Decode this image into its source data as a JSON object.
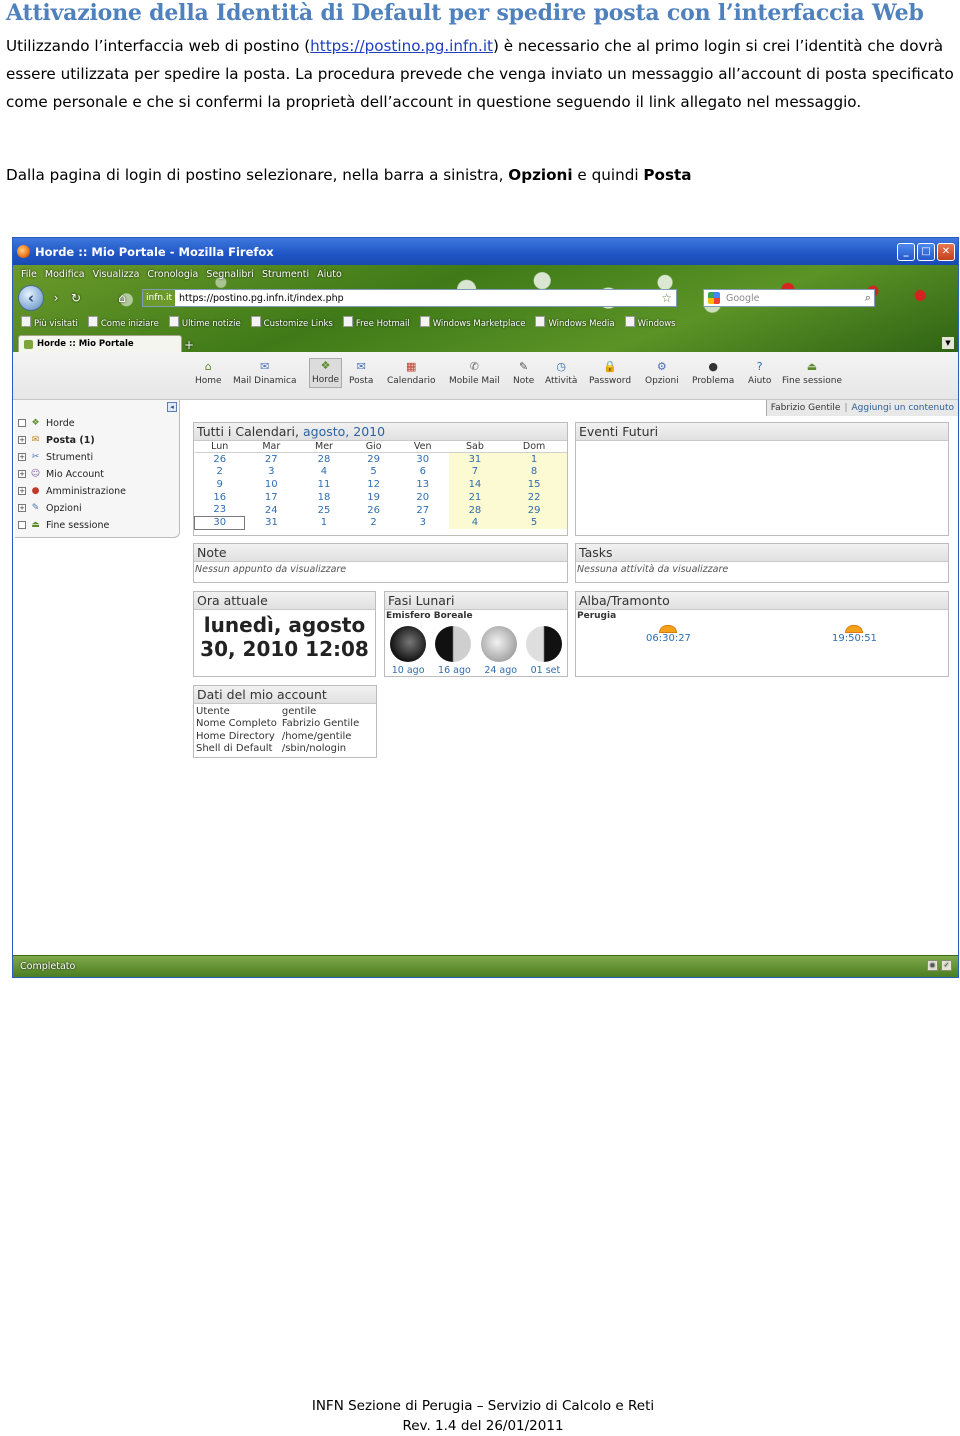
{
  "document": {
    "title": "Attivazione della Identità di Default per spedire posta con l’interfaccia Web",
    "para1_prefix": "Utilizzando l’interfaccia web di postino (",
    "para1_link": "https://postino.pg.infn.it",
    "para1_suffix": ") è necessario che al primo login si crei l’identità che dovrà essere utilizzata per spedire la posta. La procedura prevede che venga inviato un messaggio all’account di posta specificato come personale e che si confermi la proprietà dell’account in questione seguendo il link allegato nel messaggio.",
    "para2_prefix": "Dalla pagina di login di postino selezionare, nella barra a sinistra, ",
    "para2_opzioni": "Opzioni",
    "para2_mid": " e quindi ",
    "para2_posta": "Posta",
    "footer_line1": "INFN Sezione di Perugia – Servizio di Calcolo e Reti",
    "footer_line2": "Rev. 1.4 del 26/01/2011"
  },
  "browser": {
    "window_title": "Horde :: Mio Portale - Mozilla Firefox",
    "menu": [
      "File",
      "Modifica",
      "Visualizza",
      "Cronologia",
      "Segnalibri",
      "Strumenti",
      "Aiuto"
    ],
    "url_badge": "infn.it",
    "url": "https://postino.pg.infn.it/index.php",
    "search_placeholder": "Google",
    "bookmarks": [
      "Più visitati",
      "Come iniziare",
      "Ultime notizie",
      "Customize Links",
      "Free Hotmail",
      "Windows Marketplace",
      "Windows Media",
      "Windows"
    ],
    "tab_title": "Horde :: Mio Portale",
    "status_text": "Completato"
  },
  "horde": {
    "menu": [
      {
        "label": "Home",
        "icon": "home-icon"
      },
      {
        "label": "Mail Dinamica",
        "icon": "mail-icon"
      },
      {
        "label": "Horde",
        "icon": "horde-icon"
      },
      {
        "label": "Posta",
        "icon": "inbox-icon"
      },
      {
        "label": "Calendario",
        "icon": "calendar-icon"
      },
      {
        "label": "Mobile Mail",
        "icon": "mobile-icon"
      },
      {
        "label": "Note",
        "icon": "notes-icon"
      },
      {
        "label": "Attività",
        "icon": "tasks-icon"
      },
      {
        "label": "Password",
        "icon": "lock-icon"
      },
      {
        "label": "Opzioni",
        "icon": "options-icon"
      },
      {
        "label": "Problema",
        "icon": "bug-icon"
      },
      {
        "label": "Aiuto",
        "icon": "help-icon"
      },
      {
        "label": "Fine sessione",
        "icon": "logout-icon"
      }
    ],
    "user_name": "Fabrizio Gentile",
    "add_content": "Aggiungi un contenuto",
    "sidebar": [
      {
        "label": "Horde",
        "bold": false
      },
      {
        "label": "Posta (1)",
        "bold": true
      },
      {
        "label": "Strumenti",
        "bold": false
      },
      {
        "label": "Mio Account",
        "bold": false
      },
      {
        "label": "Amministrazione",
        "bold": false
      },
      {
        "label": "Opzioni",
        "bold": false
      },
      {
        "label": "Fine sessione",
        "bold": false
      }
    ],
    "calendar": {
      "title_prefix": "Tutti i Calendari, ",
      "month": "agosto, 2010",
      "days": [
        "Lun",
        "Mar",
        "Mer",
        "Gio",
        "Ven",
        "Sab",
        "Dom"
      ],
      "weeks": [
        [
          "26",
          "27",
          "28",
          "29",
          "30",
          "31",
          "1"
        ],
        [
          "2",
          "3",
          "4",
          "5",
          "6",
          "7",
          "8"
        ],
        [
          "9",
          "10",
          "11",
          "12",
          "13",
          "14",
          "15"
        ],
        [
          "16",
          "17",
          "18",
          "19",
          "20",
          "21",
          "22"
        ],
        [
          "23",
          "24",
          "25",
          "26",
          "27",
          "28",
          "29"
        ],
        [
          "30",
          "31",
          "1",
          "2",
          "3",
          "4",
          "5"
        ]
      ]
    },
    "eventi_title": "Eventi Futuri",
    "note_title": "Note",
    "note_empty": "Nessun appunto da visualizzare",
    "tasks_title": "Tasks",
    "tasks_empty": "Nessuna attività da visualizzare",
    "ora_title": "Ora attuale",
    "ora_line1": "lunedì, agosto",
    "ora_line2": "30, 2010 12:08",
    "fasi_title": "Fasi Lunari",
    "fasi_sub": "Emisfero Boreale",
    "fasi_labels": [
      "10 ago",
      "16 ago",
      "24 ago",
      "01 set"
    ],
    "alba_title": "Alba/Tramonto",
    "alba_city": "Perugia",
    "alba_sunrise": "06:30:27",
    "alba_sunset": "19:50:51",
    "account_title": "Dati del mio account",
    "account_rows": [
      [
        "Utente",
        "gentile"
      ],
      [
        "Nome Completo",
        "Fabrizio Gentile"
      ],
      [
        "Home Directory",
        "/home/gentile"
      ],
      [
        "Shell di Default",
        "/sbin/nologin"
      ]
    ]
  }
}
